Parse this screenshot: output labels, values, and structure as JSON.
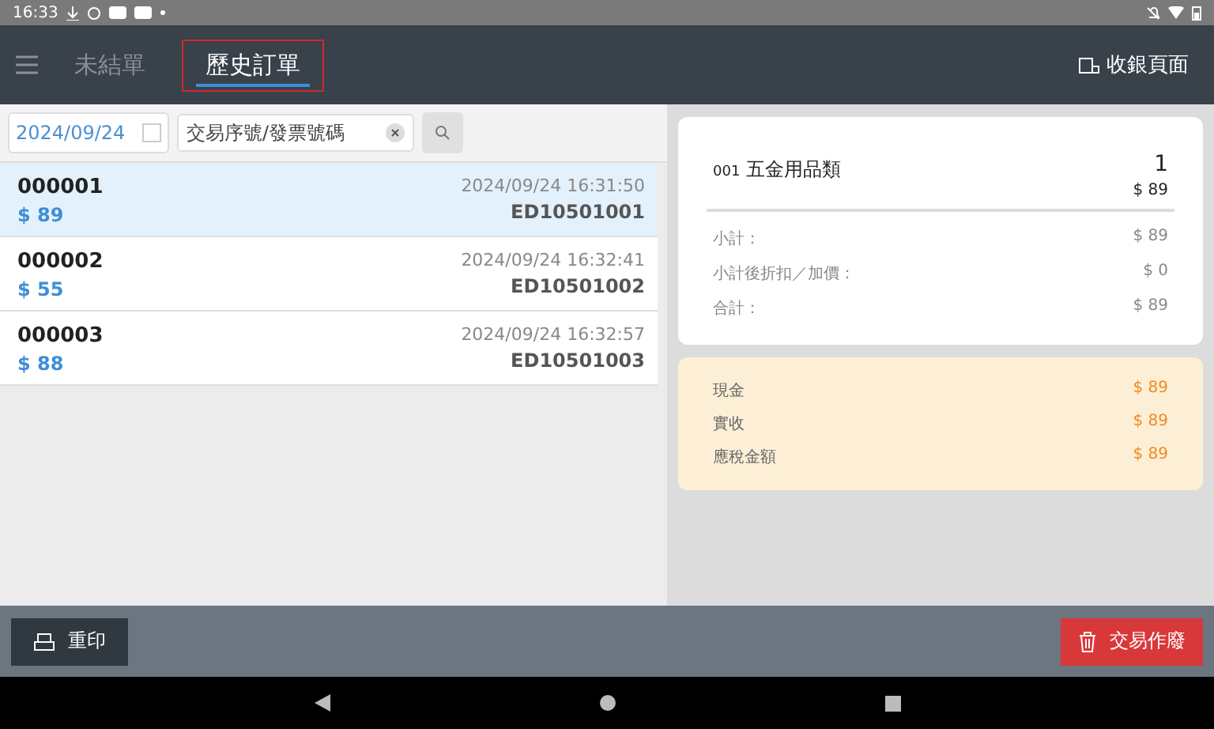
{
  "status_bar": {
    "time": "16:33"
  },
  "app_bar": {
    "tabs": [
      {
        "label": "未結單",
        "selected": false
      },
      {
        "label": "歷史訂單",
        "selected": true
      }
    ],
    "action": "收銀頁面"
  },
  "filter": {
    "date": "2024/09/24",
    "search_placeholder": "交易序號/發票號碼"
  },
  "orders": [
    {
      "number": "000001",
      "amount": "$ 89",
      "time": "2024/09/24 16:31:50",
      "invoice": "ED10501001",
      "selected": true
    },
    {
      "number": "000002",
      "amount": "$ 55",
      "time": "2024/09/24 16:32:41",
      "invoice": "ED10501002",
      "selected": false
    },
    {
      "number": "000003",
      "amount": "$ 88",
      "time": "2024/09/24 16:32:57",
      "invoice": "ED10501003",
      "selected": false
    }
  ],
  "detail": {
    "items": [
      {
        "code": "001",
        "name": "五金用品類",
        "qty": "1",
        "price": "$ 89"
      }
    ],
    "totals": [
      {
        "label": "小計：",
        "value": "$ 89"
      },
      {
        "label": "小計後折扣／加價：",
        "value": "$ 0"
      },
      {
        "label": "合計：",
        "value": "$ 89"
      }
    ],
    "payments": [
      {
        "label": "現金",
        "value": "$ 89"
      },
      {
        "label": "實收",
        "value": "$ 89"
      },
      {
        "label": "應稅金額",
        "value": "$ 89"
      }
    ]
  },
  "buttons": {
    "reprint": "重印",
    "void": "交易作廢"
  }
}
